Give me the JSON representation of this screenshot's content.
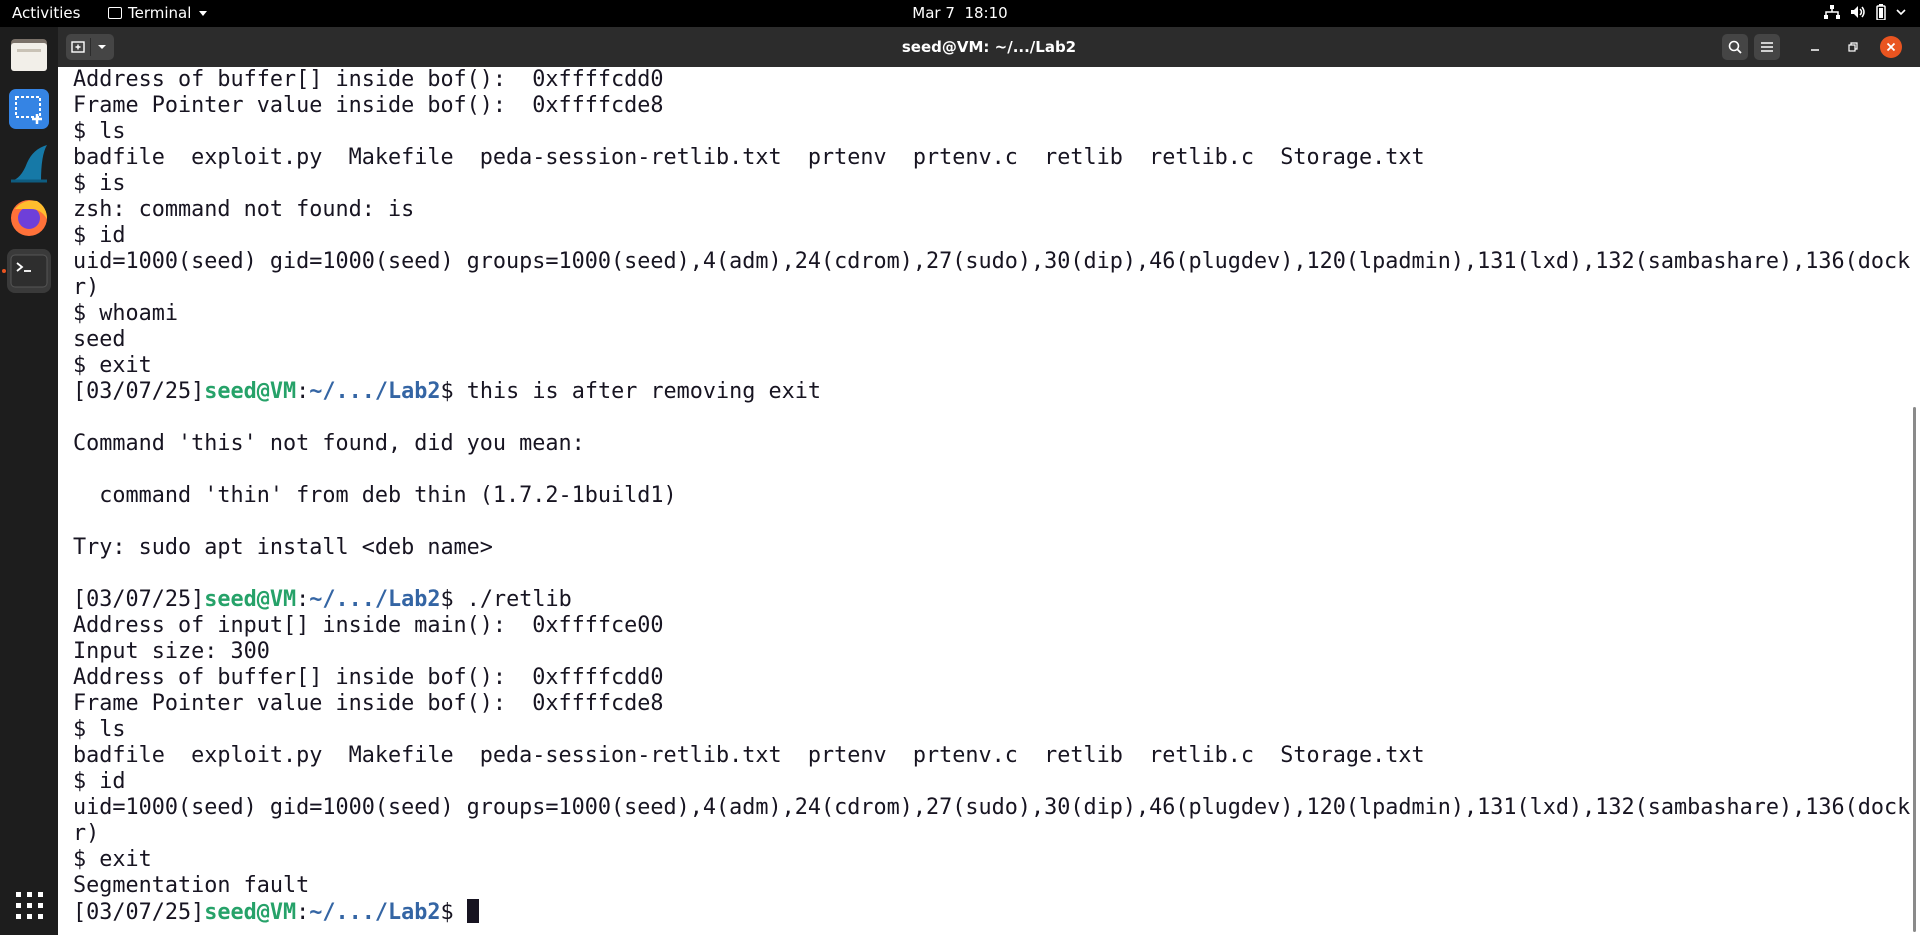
{
  "topbar": {
    "activities": "Activities",
    "app_name": "Terminal",
    "clock_date": "Mar 7",
    "clock_time": "18:10"
  },
  "dock": {
    "items": [
      {
        "name": "files-icon"
      },
      {
        "name": "screenshot-icon"
      },
      {
        "name": "wireshark-icon"
      },
      {
        "name": "firefox-icon"
      },
      {
        "name": "terminal-icon",
        "active": true
      },
      {
        "name": "show-apps-icon"
      }
    ]
  },
  "window": {
    "title": "seed@VM: ~/.../Lab2"
  },
  "prompt": {
    "date": "[03/07/25]",
    "user": "seed@VM",
    "colon": ":",
    "path": "~/.../Lab2",
    "dollar": "$ "
  },
  "terminal": {
    "lines": [
      {
        "text": "Address of buffer[] inside bof():  0xffffcdd0"
      },
      {
        "text": "Frame Pointer value inside bof():  0xffffcde8"
      },
      {
        "text": "$ ls"
      },
      {
        "text": "badfile  exploit.py  Makefile  peda-session-retlib.txt  prtenv  prtenv.c  retlib  retlib.c  Storage.txt"
      },
      {
        "text": "$ is"
      },
      {
        "text": "zsh: command not found: is"
      },
      {
        "text": "$ id"
      },
      {
        "text": "uid=1000(seed) gid=1000(seed) groups=1000(seed),4(adm),24(cdrom),27(sudo),30(dip),46(plugdev),120(lpadmin),131(lxd),132(sambashare),136(docke"
      },
      {
        "text": "r)"
      },
      {
        "text": "$ whoami"
      },
      {
        "text": "seed"
      },
      {
        "text": "$ exit"
      },
      {
        "prompt": true,
        "text": "this is after removing exit"
      },
      {
        "text": ""
      },
      {
        "text": "Command 'this' not found, did you mean:"
      },
      {
        "text": ""
      },
      {
        "text": "  command 'thin' from deb thin (1.7.2-1build1)"
      },
      {
        "text": ""
      },
      {
        "text": "Try: sudo apt install <deb name>"
      },
      {
        "text": ""
      },
      {
        "prompt": true,
        "text": "./retlib"
      },
      {
        "text": "Address of input[] inside main():  0xffffce00"
      },
      {
        "text": "Input size: 300"
      },
      {
        "text": "Address of buffer[] inside bof():  0xffffcdd0"
      },
      {
        "text": "Frame Pointer value inside bof():  0xffffcde8"
      },
      {
        "text": "$ ls"
      },
      {
        "text": "badfile  exploit.py  Makefile  peda-session-retlib.txt  prtenv  prtenv.c  retlib  retlib.c  Storage.txt"
      },
      {
        "text": "$ id"
      },
      {
        "text": "uid=1000(seed) gid=1000(seed) groups=1000(seed),4(adm),24(cdrom),27(sudo),30(dip),46(plugdev),120(lpadmin),131(lxd),132(sambashare),136(docke"
      },
      {
        "text": "r)"
      },
      {
        "text": "$ exit"
      },
      {
        "text": "Segmentation fault"
      },
      {
        "prompt": true,
        "text": "",
        "cursor": true
      }
    ]
  },
  "colors": {
    "prompt_user": "#26a269",
    "prompt_path": "#3465a4",
    "close_button": "#e95420",
    "accent": "#e95420"
  }
}
